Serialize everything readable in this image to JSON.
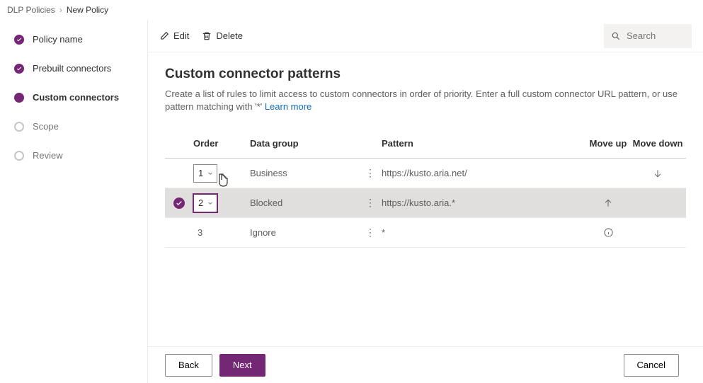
{
  "breadcrumb": {
    "parent": "DLP Policies",
    "current": "New Policy"
  },
  "steps": [
    {
      "label": "Policy name",
      "state": "done"
    },
    {
      "label": "Prebuilt connectors",
      "state": "done"
    },
    {
      "label": "Custom connectors",
      "state": "current"
    },
    {
      "label": "Scope",
      "state": "future"
    },
    {
      "label": "Review",
      "state": "future"
    }
  ],
  "toolbar": {
    "edit_label": "Edit",
    "delete_label": "Delete",
    "search_placeholder": "Search"
  },
  "page": {
    "title": "Custom connector patterns",
    "description_prefix": "Create a list of rules to limit access to custom connectors in order of priority. Enter a full custom connector URL pattern, or use pattern matching with '*' ",
    "learn_more": "Learn more"
  },
  "table": {
    "headers": {
      "order": "Order",
      "data_group": "Data group",
      "pattern": "Pattern",
      "move_up": "Move up",
      "move_down": "Move down"
    },
    "rows": [
      {
        "selected": false,
        "order": "1",
        "editable_order": true,
        "data_group": "Business",
        "pattern": "https://kusto.aria.net/",
        "can_up": false,
        "can_down": true,
        "info": false
      },
      {
        "selected": true,
        "order": "2",
        "editable_order": true,
        "data_group": "Blocked",
        "pattern": "https://kusto.aria.*",
        "can_up": true,
        "can_down": false,
        "info": false
      },
      {
        "selected": false,
        "order": "3",
        "editable_order": false,
        "data_group": "Ignore",
        "pattern": "*",
        "can_up": false,
        "can_down": false,
        "info": true
      }
    ]
  },
  "footer": {
    "back": "Back",
    "next": "Next",
    "cancel": "Cancel"
  }
}
